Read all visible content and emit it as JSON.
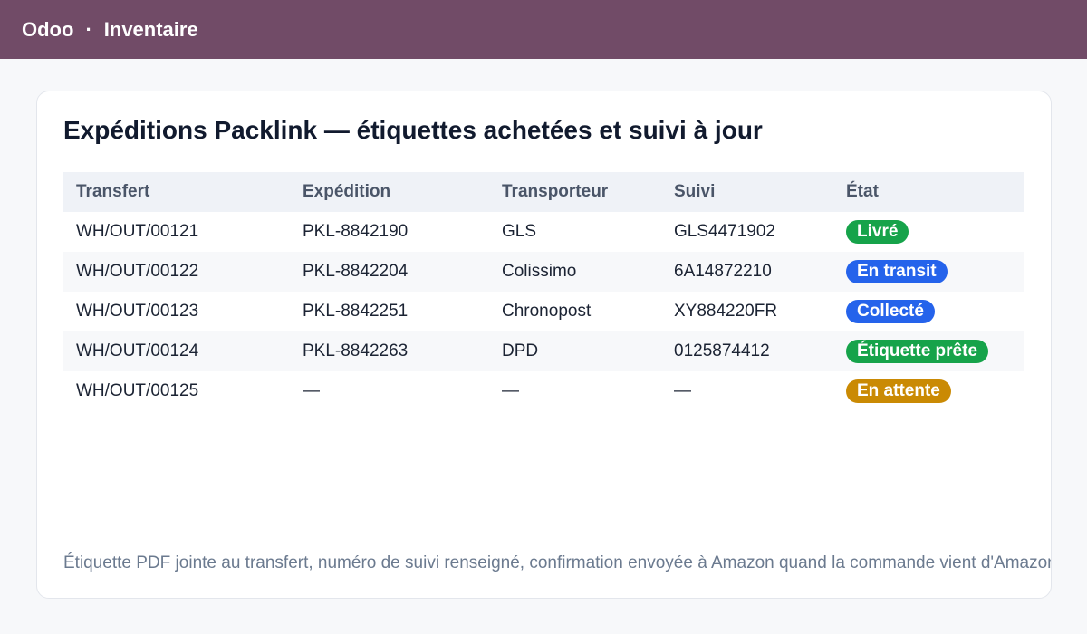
{
  "header": {
    "app_name": "Odoo",
    "separator": "·",
    "module": "Inventaire"
  },
  "card": {
    "title": "Expéditions Packlink — étiquettes achetées et suivi à jour",
    "columns": [
      "Transfert",
      "Expédition",
      "Transporteur",
      "Suivi",
      "État"
    ],
    "rows": [
      {
        "transfer": "WH/OUT/00121",
        "shipment": "PKL-8842190",
        "carrier": "GLS",
        "tracking": "GLS4471902",
        "status": "Livré",
        "status_color": "#16a34a"
      },
      {
        "transfer": "WH/OUT/00122",
        "shipment": "PKL-8842204",
        "carrier": "Colissimo",
        "tracking": "6A14872210",
        "status": "En transit",
        "status_color": "#2563eb"
      },
      {
        "transfer": "WH/OUT/00123",
        "shipment": "PKL-8842251",
        "carrier": "Chronopost",
        "tracking": "XY884220FR",
        "status": "Collecté",
        "status_color": "#2563eb"
      },
      {
        "transfer": "WH/OUT/00124",
        "shipment": "PKL-8842263",
        "carrier": "DPD",
        "tracking": "0125874412",
        "status": "Étiquette prête",
        "status_color": "#16a34a"
      },
      {
        "transfer": "WH/OUT/00125",
        "shipment": "—",
        "carrier": "—",
        "tracking": "—",
        "status": "En attente",
        "status_color": "#ca8a04"
      }
    ],
    "footnote": "Étiquette PDF jointe au transfert, numéro de suivi renseigné, confirmation envoyée à Amazon quand la commande vient d'Amazon."
  },
  "colors": {
    "brand": "#714b67",
    "delivered": "#16a34a",
    "in_transit": "#2563eb",
    "pending": "#ca8a04"
  }
}
